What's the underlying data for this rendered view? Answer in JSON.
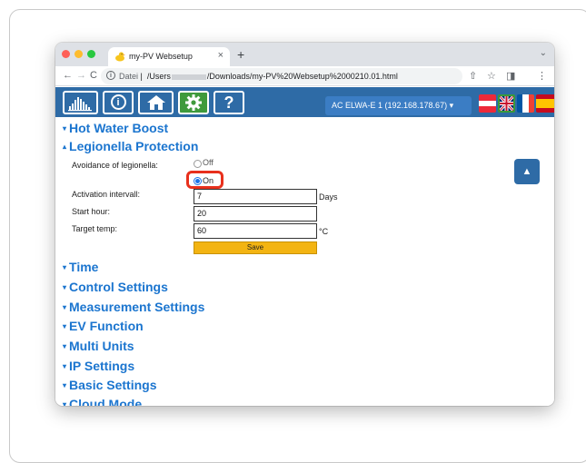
{
  "browser": {
    "tab_title": "my-PV Websetup",
    "tab_close": "×",
    "new_tab": "+",
    "tab_menu": "⌄",
    "url_scheme": "Datei",
    "url_prefix": "/Users",
    "url_rest": "/Downloads/my-PV%20Websetup%2000210.01.html",
    "back": "←",
    "forward": "→",
    "reload": "C",
    "share": "⇧",
    "bookmark": "☆",
    "sidepanel": "◨",
    "menu": "⋮"
  },
  "navbar": {
    "home_icon": "house-icon",
    "settings_icon": "gear-icon",
    "help_label": "?",
    "info_label": "i",
    "device_select": "AC ELWA-E 1 (192.168.178.67) ▾"
  },
  "sections": {
    "hot_water_boost": "Hot Water Boost",
    "legionella_protection": "Legionella Protection",
    "time": "Time",
    "control_settings": "Control Settings",
    "measurement_settings": "Measurement Settings",
    "ev_function": "EV Function",
    "multi_units": "Multi Units",
    "ip_settings": "IP Settings",
    "basic_settings": "Basic Settings",
    "cloud_mode": "Cloud Mode"
  },
  "arrows": {
    "collapsed": "▾",
    "expanded": "▴"
  },
  "legionella": {
    "avoidance_label": "Avoidance of legionella:",
    "option_off": "Off",
    "option_on": "On",
    "selected": "On",
    "activation_label": "Activation intervall:",
    "activation_value": "7",
    "activation_unit": "Days",
    "start_label": "Start hour:",
    "start_value": "20",
    "target_label": "Target temp:",
    "target_value": "60",
    "target_unit": "°C",
    "save_label": "Save"
  },
  "scroll_top_label": "▲",
  "colors": {
    "navbar_bg": "#2e6ba6",
    "section_link": "#1b75cf",
    "save_button": "#f3b412",
    "highlight": "#e8301c"
  }
}
